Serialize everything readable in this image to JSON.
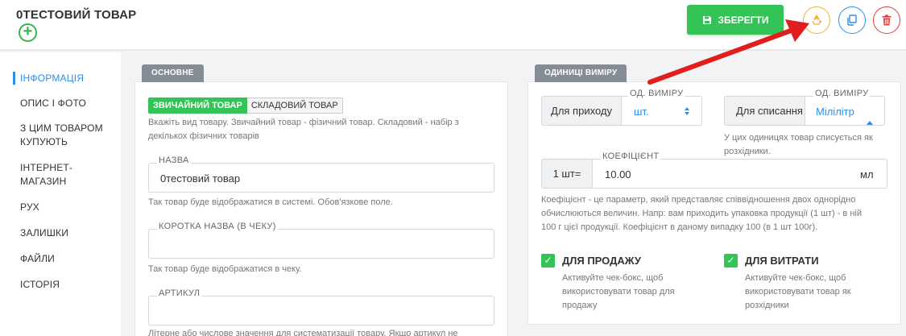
{
  "header": {
    "title": "0ТЕСТОВИЙ ТОВАР",
    "add_icon": "+",
    "save_label": "ЗБЕРЕГТИ",
    "save_icon": "floppy-disk-icon",
    "action_icons": [
      "recycle-icon",
      "copy-icon",
      "trash-icon"
    ],
    "colors": {
      "save": "#34c356",
      "recycle": "#f0b23a",
      "copy": "#2c8ee8",
      "delete": "#e23b3b",
      "arrow": "#e01e1e"
    }
  },
  "sidebar": {
    "items": [
      {
        "label": "ІНФОРМАЦІЯ",
        "active": true
      },
      {
        "label": "ОПИС І ФОТО"
      },
      {
        "label": "З ЦИМ ТОВАРОМ"
      },
      {
        "label": "КУПУЮТЬ"
      },
      {
        "label": "ІНТЕРНЕТ-"
      },
      {
        "label": "МАГАЗИН"
      },
      {
        "label": "РУХ"
      },
      {
        "label": "ЗАЛИШКИ"
      },
      {
        "label": "ФАЙЛИ"
      },
      {
        "label": "ІСТОРІЯ"
      }
    ]
  },
  "main": {
    "tab": "ОСНОВНЕ",
    "type_toggle": {
      "regular": "ЗВИЧАЙНИЙ ТОВАР",
      "composite": "СКЛАДОВИЙ ТОВАР"
    },
    "type_hint_1": "Вкажіть вид товару. Звичайний товар - фізичний товар. Складовий - набір з",
    "type_hint_2": "декількох фізичних товарів",
    "name_label": "НАЗВА",
    "name_value": "0тестовий товар",
    "name_hint": "Так товар буде відображатися в системі. Обов'язкове поле.",
    "short_name_label": "КОРОТКА НАЗВА (В ЧЕКУ)",
    "short_name_value": "",
    "short_name_hint": "Так товар буде відображатися в чеку.",
    "sku_label": "АРТИКУЛ",
    "sku_value": "",
    "sku_hint": "Літерне або числове значення для систематизації товару. Якщо артикул не"
  },
  "units": {
    "tab": "ОДИНИЦІ ВИМІРУ",
    "income_label": "Для приходу",
    "income_unit_label": "ОД. ВИМІРУ",
    "income_unit_value": "шт.",
    "writeoff_label": "Для списання",
    "writeoff_unit_label": "ОД. ВИМІРУ",
    "writeoff_unit_value": "Мілілітр",
    "writeoff_hint_1": "У цих одиницях товар списується як",
    "writeoff_hint_2": "розхідники.",
    "coef_prefix": "1 шт=",
    "coef_label": "КОЕФІЦІЄНТ",
    "coef_value": "10.00",
    "coef_suffix": "мл",
    "coef_hint_1": "Коефіцієнт - це параметр, який представляє співвідношення двох однорідно",
    "coef_hint_2": "обчислюються величин. Напр: вам приходить упаковка продукції (1 шт) - в ній",
    "coef_hint_3": "100 г цієї продукції. Коефіцієнт в даному випадку 100 (в 1 шт 100г).",
    "for_sale_label": "ДЛЯ ПРОДАЖУ",
    "for_sale_hint_1": "Активуйте чек-бокс, щоб",
    "for_sale_hint_2": "використовувати товар для",
    "for_sale_hint_3": "продажу",
    "for_expense_label": "ДЛЯ ВИТРАТИ",
    "for_expense_hint_1": "Активуйте чек-бокс, щоб",
    "for_expense_hint_2": "використовувати товар як",
    "for_expense_hint_3": "розхідники"
  }
}
